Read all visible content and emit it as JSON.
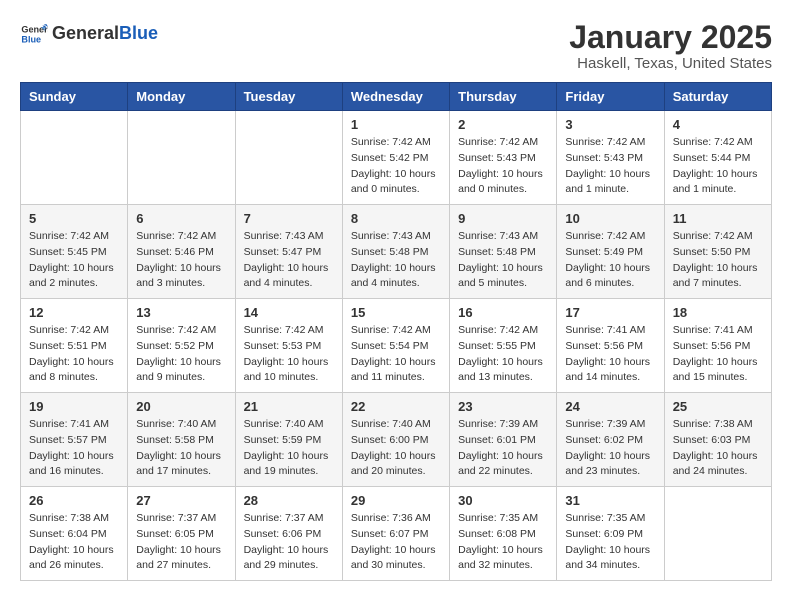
{
  "header": {
    "logo_general": "General",
    "logo_blue": "Blue",
    "title": "January 2025",
    "subtitle": "Haskell, Texas, United States"
  },
  "weekdays": [
    "Sunday",
    "Monday",
    "Tuesday",
    "Wednesday",
    "Thursday",
    "Friday",
    "Saturday"
  ],
  "weeks": [
    [
      {
        "day": "",
        "info": ""
      },
      {
        "day": "",
        "info": ""
      },
      {
        "day": "",
        "info": ""
      },
      {
        "day": "1",
        "info": "Sunrise: 7:42 AM\nSunset: 5:42 PM\nDaylight: 10 hours\nand 0 minutes."
      },
      {
        "day": "2",
        "info": "Sunrise: 7:42 AM\nSunset: 5:43 PM\nDaylight: 10 hours\nand 0 minutes."
      },
      {
        "day": "3",
        "info": "Sunrise: 7:42 AM\nSunset: 5:43 PM\nDaylight: 10 hours\nand 1 minute."
      },
      {
        "day": "4",
        "info": "Sunrise: 7:42 AM\nSunset: 5:44 PM\nDaylight: 10 hours\nand 1 minute."
      }
    ],
    [
      {
        "day": "5",
        "info": "Sunrise: 7:42 AM\nSunset: 5:45 PM\nDaylight: 10 hours\nand 2 minutes."
      },
      {
        "day": "6",
        "info": "Sunrise: 7:42 AM\nSunset: 5:46 PM\nDaylight: 10 hours\nand 3 minutes."
      },
      {
        "day": "7",
        "info": "Sunrise: 7:43 AM\nSunset: 5:47 PM\nDaylight: 10 hours\nand 4 minutes."
      },
      {
        "day": "8",
        "info": "Sunrise: 7:43 AM\nSunset: 5:48 PM\nDaylight: 10 hours\nand 4 minutes."
      },
      {
        "day": "9",
        "info": "Sunrise: 7:43 AM\nSunset: 5:48 PM\nDaylight: 10 hours\nand 5 minutes."
      },
      {
        "day": "10",
        "info": "Sunrise: 7:42 AM\nSunset: 5:49 PM\nDaylight: 10 hours\nand 6 minutes."
      },
      {
        "day": "11",
        "info": "Sunrise: 7:42 AM\nSunset: 5:50 PM\nDaylight: 10 hours\nand 7 minutes."
      }
    ],
    [
      {
        "day": "12",
        "info": "Sunrise: 7:42 AM\nSunset: 5:51 PM\nDaylight: 10 hours\nand 8 minutes."
      },
      {
        "day": "13",
        "info": "Sunrise: 7:42 AM\nSunset: 5:52 PM\nDaylight: 10 hours\nand 9 minutes."
      },
      {
        "day": "14",
        "info": "Sunrise: 7:42 AM\nSunset: 5:53 PM\nDaylight: 10 hours\nand 10 minutes."
      },
      {
        "day": "15",
        "info": "Sunrise: 7:42 AM\nSunset: 5:54 PM\nDaylight: 10 hours\nand 11 minutes."
      },
      {
        "day": "16",
        "info": "Sunrise: 7:42 AM\nSunset: 5:55 PM\nDaylight: 10 hours\nand 13 minutes."
      },
      {
        "day": "17",
        "info": "Sunrise: 7:41 AM\nSunset: 5:56 PM\nDaylight: 10 hours\nand 14 minutes."
      },
      {
        "day": "18",
        "info": "Sunrise: 7:41 AM\nSunset: 5:56 PM\nDaylight: 10 hours\nand 15 minutes."
      }
    ],
    [
      {
        "day": "19",
        "info": "Sunrise: 7:41 AM\nSunset: 5:57 PM\nDaylight: 10 hours\nand 16 minutes."
      },
      {
        "day": "20",
        "info": "Sunrise: 7:40 AM\nSunset: 5:58 PM\nDaylight: 10 hours\nand 17 minutes."
      },
      {
        "day": "21",
        "info": "Sunrise: 7:40 AM\nSunset: 5:59 PM\nDaylight: 10 hours\nand 19 minutes."
      },
      {
        "day": "22",
        "info": "Sunrise: 7:40 AM\nSunset: 6:00 PM\nDaylight: 10 hours\nand 20 minutes."
      },
      {
        "day": "23",
        "info": "Sunrise: 7:39 AM\nSunset: 6:01 PM\nDaylight: 10 hours\nand 22 minutes."
      },
      {
        "day": "24",
        "info": "Sunrise: 7:39 AM\nSunset: 6:02 PM\nDaylight: 10 hours\nand 23 minutes."
      },
      {
        "day": "25",
        "info": "Sunrise: 7:38 AM\nSunset: 6:03 PM\nDaylight: 10 hours\nand 24 minutes."
      }
    ],
    [
      {
        "day": "26",
        "info": "Sunrise: 7:38 AM\nSunset: 6:04 PM\nDaylight: 10 hours\nand 26 minutes."
      },
      {
        "day": "27",
        "info": "Sunrise: 7:37 AM\nSunset: 6:05 PM\nDaylight: 10 hours\nand 27 minutes."
      },
      {
        "day": "28",
        "info": "Sunrise: 7:37 AM\nSunset: 6:06 PM\nDaylight: 10 hours\nand 29 minutes."
      },
      {
        "day": "29",
        "info": "Sunrise: 7:36 AM\nSunset: 6:07 PM\nDaylight: 10 hours\nand 30 minutes."
      },
      {
        "day": "30",
        "info": "Sunrise: 7:35 AM\nSunset: 6:08 PM\nDaylight: 10 hours\nand 32 minutes."
      },
      {
        "day": "31",
        "info": "Sunrise: 7:35 AM\nSunset: 6:09 PM\nDaylight: 10 hours\nand 34 minutes."
      },
      {
        "day": "",
        "info": ""
      }
    ]
  ]
}
